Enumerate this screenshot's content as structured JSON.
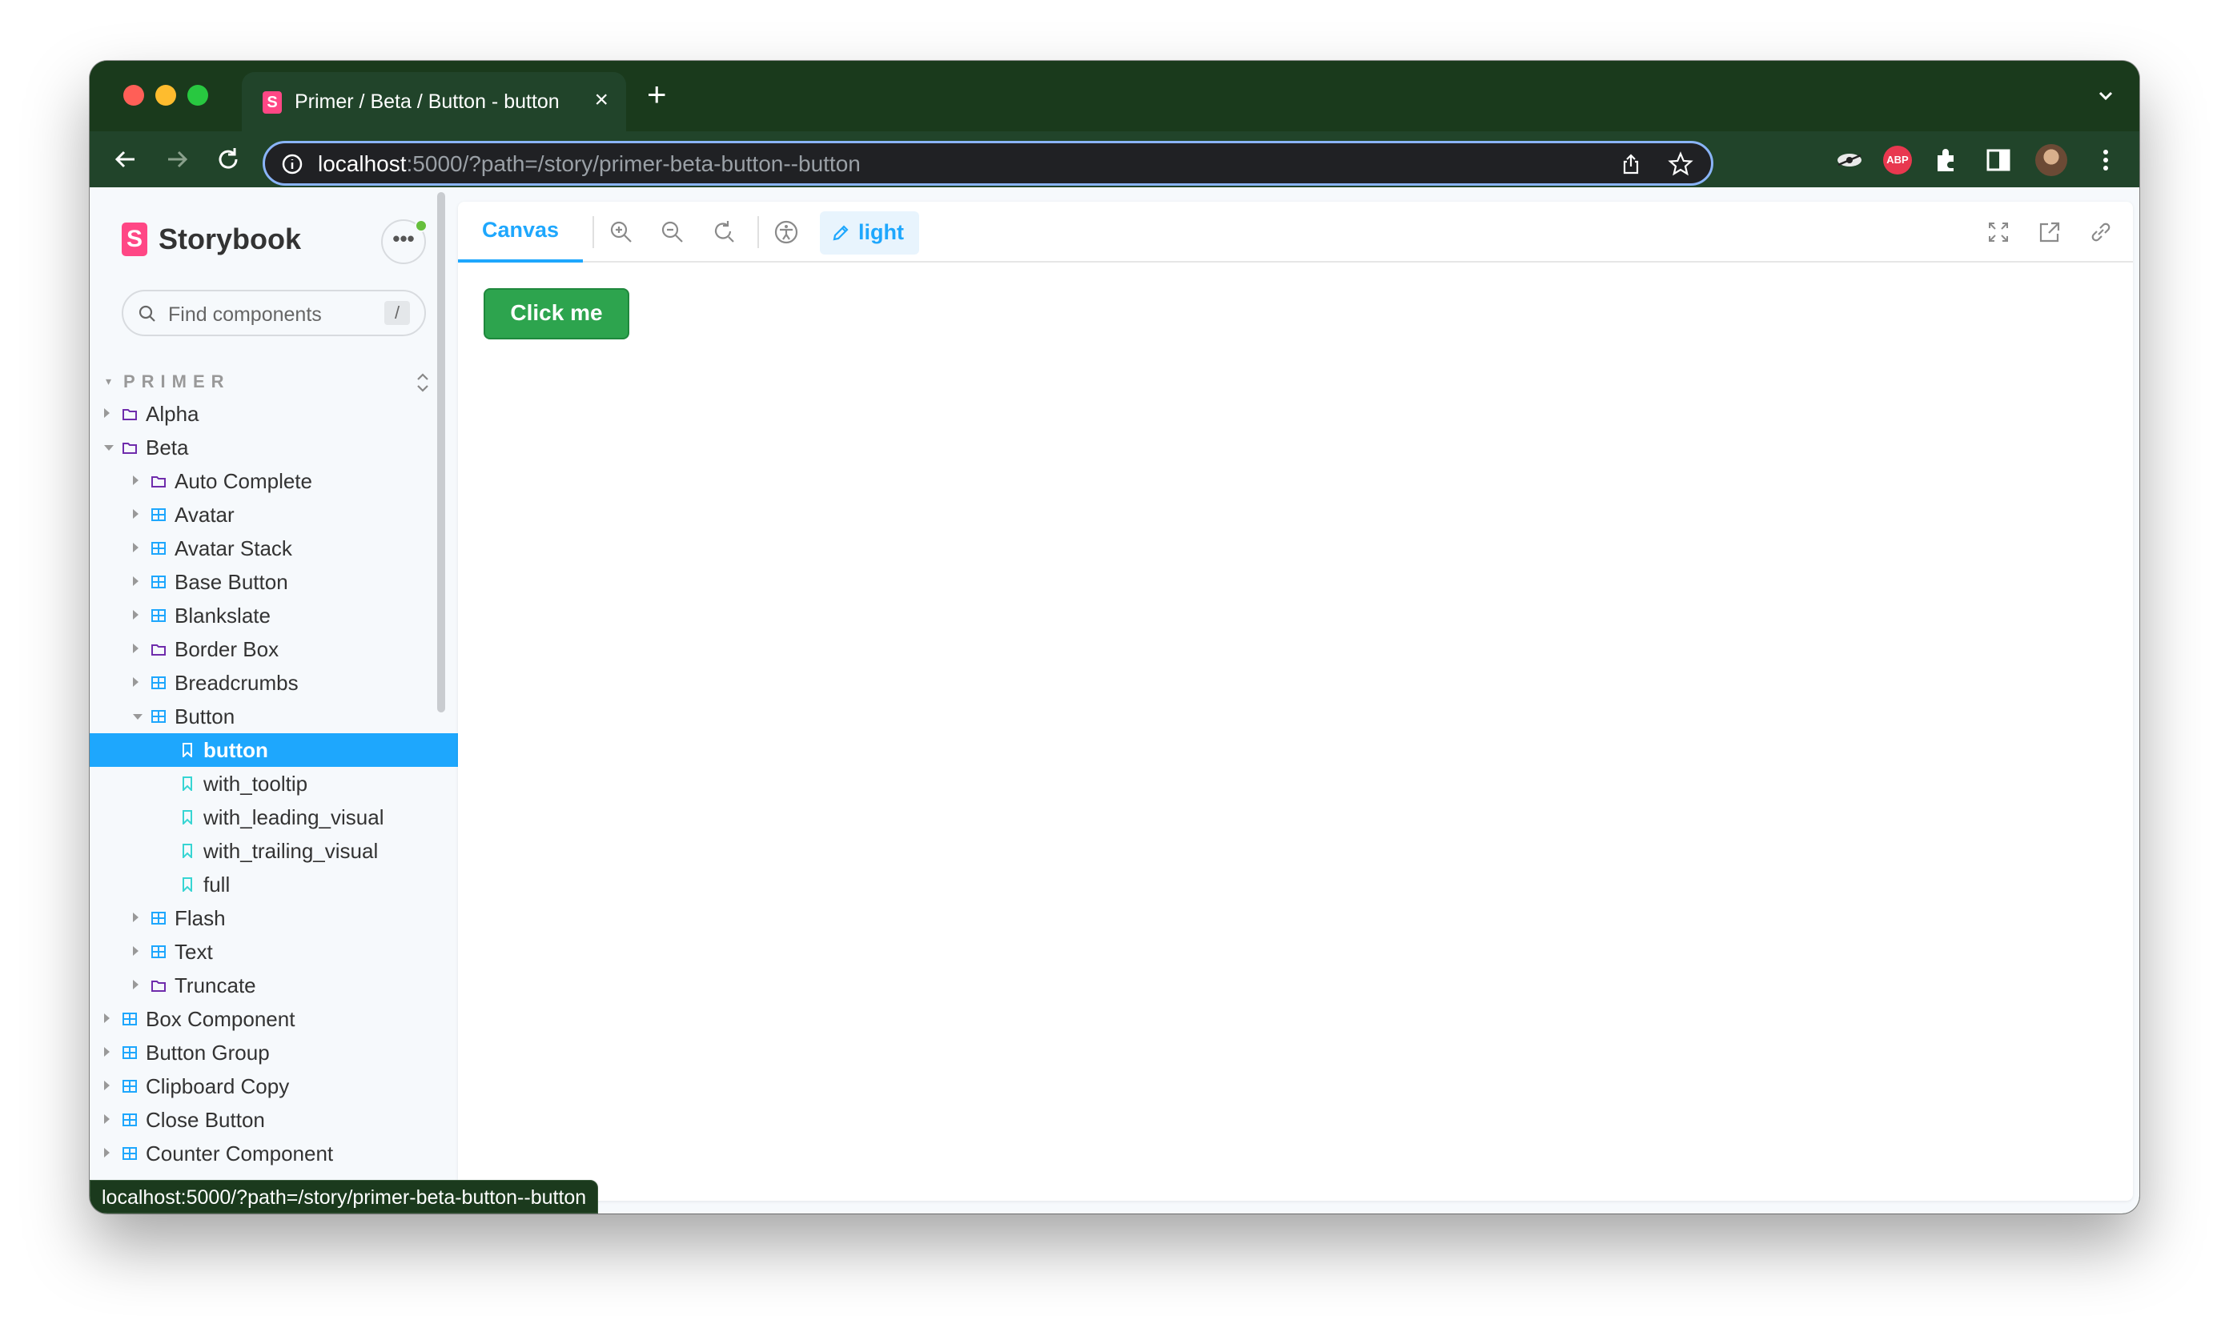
{
  "browser": {
    "tab_title": "Primer / Beta / Button - button",
    "url_host": "localhost",
    "url_rest": ":5000/?path=/story/primer-beta-button--button",
    "extension_abp": "ABP",
    "status_url": "localhost:5000/?path=/story/primer-beta-button--button"
  },
  "sidebar": {
    "brand": "Storybook",
    "brand_mark": "S",
    "menu_label": "•••",
    "search_placeholder": "Find components",
    "search_shortcut": "/",
    "section": "PRIMER",
    "tree": [
      {
        "label": "Alpha",
        "depth": 0,
        "icon": "folder-icon",
        "state": "closed"
      },
      {
        "label": "Beta",
        "depth": 0,
        "icon": "folder-icon",
        "state": "open"
      },
      {
        "label": "Auto Complete",
        "depth": 1,
        "icon": "folder-icon",
        "state": "closed"
      },
      {
        "label": "Avatar",
        "depth": 1,
        "icon": "component-icon",
        "state": "closed"
      },
      {
        "label": "Avatar Stack",
        "depth": 1,
        "icon": "component-icon",
        "state": "closed"
      },
      {
        "label": "Base Button",
        "depth": 1,
        "icon": "component-icon",
        "state": "closed"
      },
      {
        "label": "Blankslate",
        "depth": 1,
        "icon": "component-icon",
        "state": "closed"
      },
      {
        "label": "Border Box",
        "depth": 1,
        "icon": "folder-icon",
        "state": "closed"
      },
      {
        "label": "Breadcrumbs",
        "depth": 1,
        "icon": "component-icon",
        "state": "closed"
      },
      {
        "label": "Button",
        "depth": 1,
        "icon": "component-icon",
        "state": "open"
      },
      {
        "label": "button",
        "depth": 2,
        "icon": "story-icon",
        "state": "leaf",
        "selected": true
      },
      {
        "label": "with_tooltip",
        "depth": 2,
        "icon": "story-icon",
        "state": "leaf"
      },
      {
        "label": "with_leading_visual",
        "depth": 2,
        "icon": "story-icon",
        "state": "leaf"
      },
      {
        "label": "with_trailing_visual",
        "depth": 2,
        "icon": "story-icon",
        "state": "leaf"
      },
      {
        "label": "full",
        "depth": 2,
        "icon": "story-icon",
        "state": "leaf"
      },
      {
        "label": "Flash",
        "depth": 1,
        "icon": "component-icon",
        "state": "closed"
      },
      {
        "label": "Text",
        "depth": 1,
        "icon": "component-icon",
        "state": "closed"
      },
      {
        "label": "Truncate",
        "depth": 1,
        "icon": "folder-icon",
        "state": "closed"
      },
      {
        "label": "Box Component",
        "depth": 0,
        "icon": "component-icon",
        "state": "closed"
      },
      {
        "label": "Button Group",
        "depth": 0,
        "icon": "component-icon",
        "state": "closed"
      },
      {
        "label": "Clipboard Copy",
        "depth": 0,
        "icon": "component-icon",
        "state": "closed"
      },
      {
        "label": "Close Button",
        "depth": 0,
        "icon": "component-icon",
        "state": "closed"
      },
      {
        "label": "Counter Component",
        "depth": 0,
        "icon": "component-icon",
        "state": "closed"
      }
    ]
  },
  "toolbar": {
    "canvas_tab": "Canvas",
    "theme_label": "light"
  },
  "preview": {
    "button_label": "Click me"
  },
  "colors": {
    "accent": "#1ea7fd",
    "brand": "#ff4785",
    "primary_button": "#2da44e",
    "folder": "#6f2cac",
    "component": "#1ea7fd",
    "story": "#37d5d3"
  }
}
